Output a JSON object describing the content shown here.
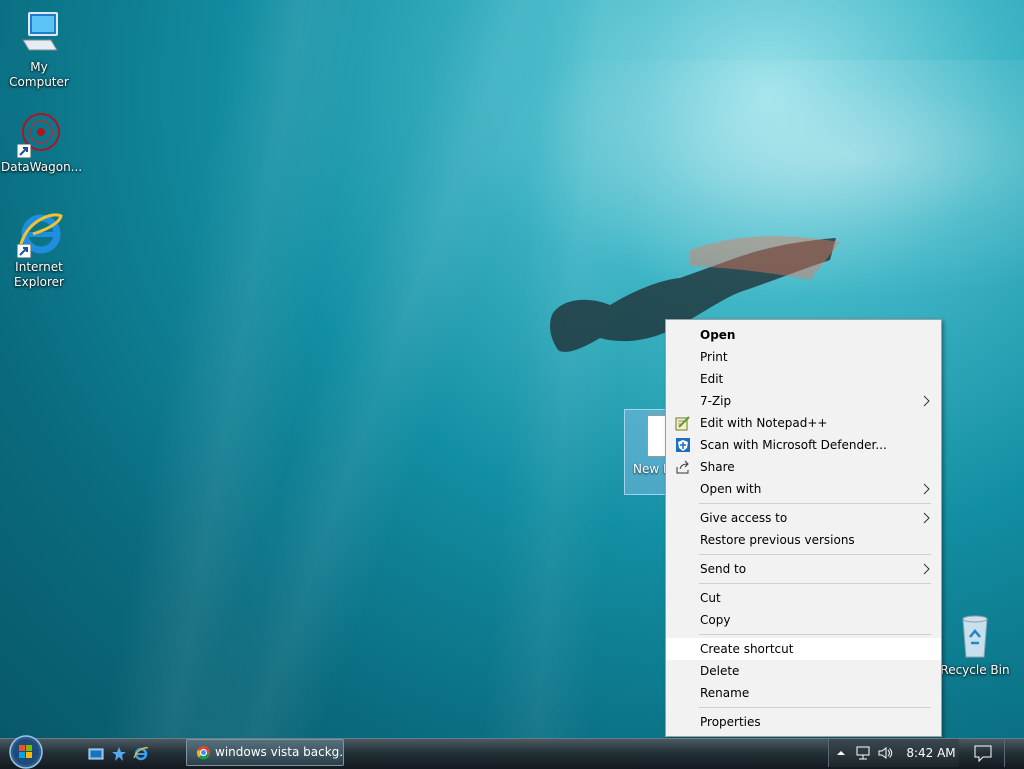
{
  "desktop": {
    "icons": [
      {
        "label": "My Computer",
        "icon": "computer-icon"
      },
      {
        "label": "DataWagon...",
        "icon": "datawagon-icon"
      },
      {
        "label": "Internet Explorer",
        "icon": "internet-explorer-icon"
      },
      {
        "label": "Recycle Bin",
        "icon": "recycle-bin-icon"
      }
    ],
    "selected_file_label": "New Docu"
  },
  "context_menu": {
    "items": [
      {
        "label": "Open",
        "bold": true
      },
      {
        "label": "Print"
      },
      {
        "label": "Edit"
      },
      {
        "label": "7-Zip",
        "submenu": true
      },
      {
        "label": "Edit with Notepad++",
        "icon": "notepad-plus-plus-icon"
      },
      {
        "label": "Scan with Microsoft Defender...",
        "icon": "defender-shield-icon"
      },
      {
        "label": "Share",
        "icon": "share-icon"
      },
      {
        "label": "Open with",
        "submenu": true
      },
      {
        "label": "Give access to",
        "submenu": true
      },
      {
        "label": "Restore previous versions"
      },
      {
        "label": "Send to",
        "submenu": true
      },
      {
        "label": "Cut"
      },
      {
        "label": "Copy"
      },
      {
        "label": "Create shortcut",
        "highlighted": true
      },
      {
        "label": "Delete"
      },
      {
        "label": "Rename"
      },
      {
        "label": "Properties"
      }
    ]
  },
  "taskbar": {
    "task_button_label": "windows vista backg...",
    "task_button_icon": "chrome-icon",
    "clock": "8:42 AM"
  },
  "colors": {
    "menu_bg": "#f2f2f2",
    "menu_highlight": "#ffffff",
    "taskbar_dark": "#1c262c"
  }
}
